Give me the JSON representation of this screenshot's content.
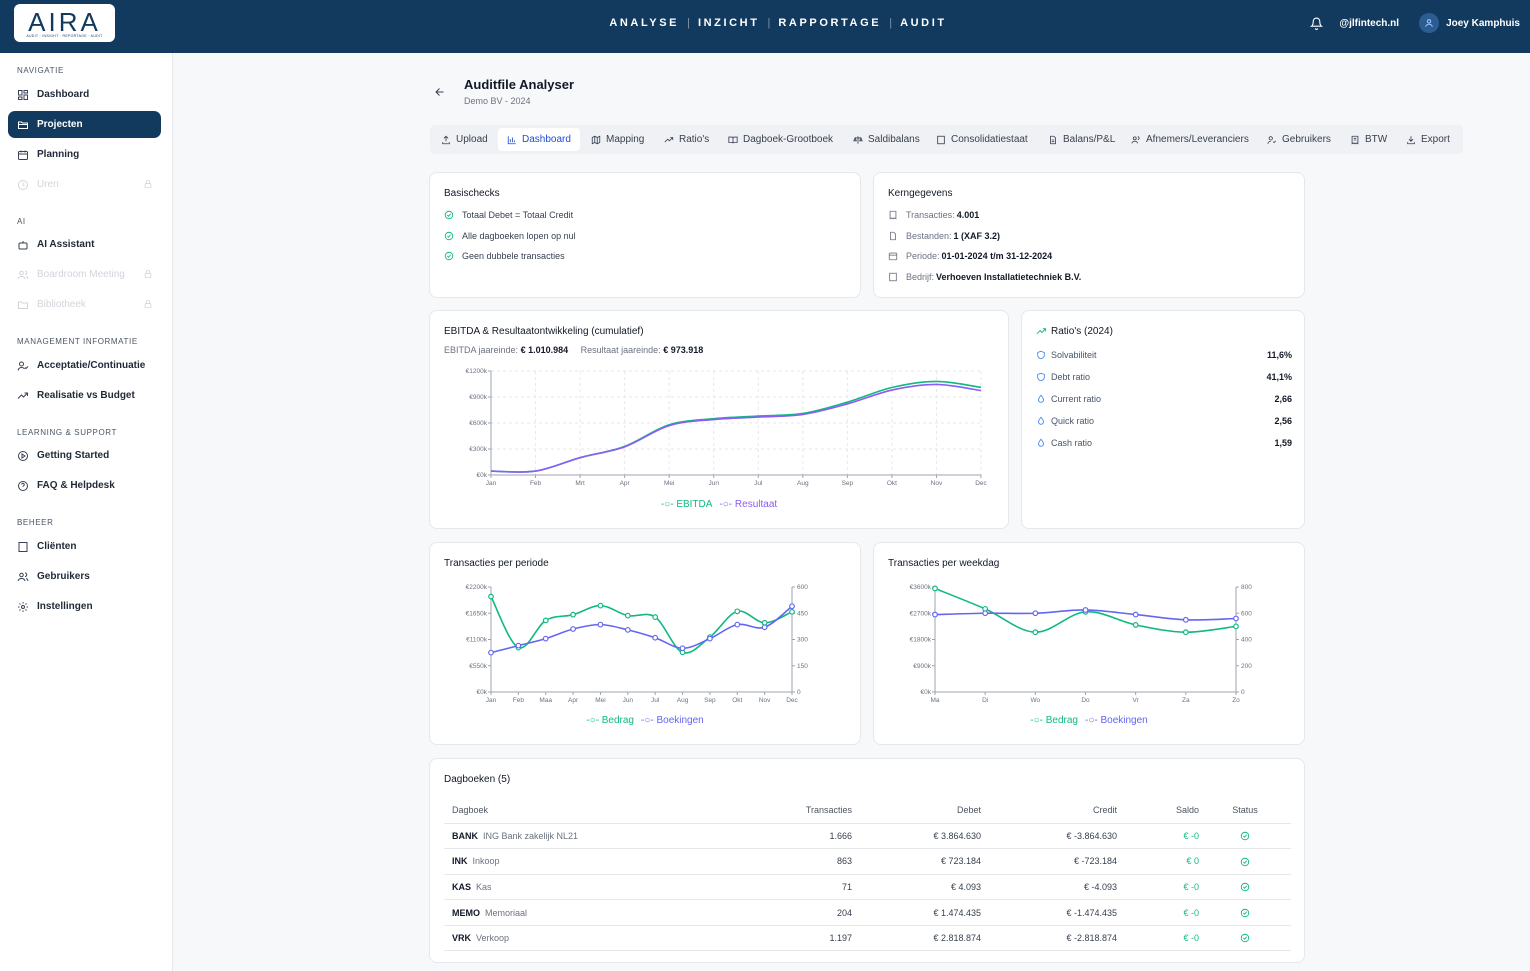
{
  "topbar": {
    "logo": "AIRA",
    "logo_tagline": "AUDIT · INSIGHT · REPORTAGE · AUDIT",
    "nav": [
      "ANALYSE",
      "INZICHT",
      "RAPPORTAGE",
      "AUDIT"
    ],
    "domain": "@jlfintech.nl",
    "user": "Joey Kamphuis"
  },
  "sidebar": {
    "navigatie_label": "NAVIGATIE",
    "ai_label": "AI",
    "mi_label": "MANAGEMENT INFORMATIE",
    "learning_label": "LEARNING & SUPPORT",
    "beheer_label": "BEHEER",
    "items": {
      "dashboard": "Dashboard",
      "projecten": "Projecten",
      "planning": "Planning",
      "uren": "Uren",
      "ai_assistant": "AI Assistant",
      "boardroom": "Boardroom Meeting",
      "bibliotheek": "Bibliotheek",
      "acceptatie": "Acceptatie/Continuatie",
      "realisatie": "Realisatie vs Budget",
      "getting_started": "Getting Started",
      "faq": "FAQ & Helpdesk",
      "clienten": "Cliënten",
      "gebruikers": "Gebruikers",
      "instellingen": "Instellingen"
    }
  },
  "page": {
    "title": "Auditfile Analyser",
    "subtitle": "Demo BV - 2024"
  },
  "tabs": [
    "Upload",
    "Dashboard",
    "Mapping",
    "Ratio's",
    "Dagboek-Grootboek",
    "Saldibalans",
    "Consolidatiestaat",
    "Balans/P&L",
    "Afnemers/Leveranciers",
    "Gebruikers",
    "BTW",
    "Export"
  ],
  "basischecks": {
    "title": "Basischecks",
    "items": [
      "Totaal Debet = Totaal Credit",
      "Alle dagboeken lopen op nul",
      "Geen dubbele transacties"
    ]
  },
  "kerngegevens": {
    "title": "Kerngegevens",
    "rows": [
      {
        "label": "Transacties:",
        "value": "4.001"
      },
      {
        "label": "Bestanden:",
        "value": "1 (XAF 3.2)"
      },
      {
        "label": "Periode:",
        "value": "01-01-2024 t/m 31-12-2024"
      },
      {
        "label": "Bedrijf:",
        "value": "Verhoeven Installatietechniek B.V."
      }
    ]
  },
  "ebitda": {
    "title": "EBITDA & Resultaatontwikkeling (cumulatief)",
    "ebitda_label": "EBITDA jaareinde:",
    "ebitda_value": "€ 1.010.984",
    "resultaat_label": "Resultaat jaareinde:",
    "resultaat_value": "€ 973.918"
  },
  "ratios": {
    "title": "Ratio's (2024)",
    "rows": [
      {
        "label": "Solvabiliteit",
        "value": "11,6%"
      },
      {
        "label": "Debt ratio",
        "value": "41,1%"
      },
      {
        "label": "Current ratio",
        "value": "2,66"
      },
      {
        "label": "Quick ratio",
        "value": "2,56"
      },
      {
        "label": "Cash ratio",
        "value": "1,59"
      }
    ]
  },
  "transacties_periode": {
    "title": "Transacties per periode"
  },
  "transacties_weekdag": {
    "title": "Transacties per weekdag"
  },
  "dagboeken": {
    "title": "Dagboeken (5)",
    "headers": [
      "Dagboek",
      "Transacties",
      "Debet",
      "Credit",
      "Saldo",
      "Status"
    ],
    "rows": [
      {
        "code": "BANK",
        "name": "ING Bank zakelijk NL21",
        "transacties": "1.666",
        "debet": "€ 3.864.630",
        "credit": "€ -3.864.630",
        "saldo": "€ -0"
      },
      {
        "code": "INK",
        "name": "Inkoop",
        "transacties": "863",
        "debet": "€ 723.184",
        "credit": "€ -723.184",
        "saldo": "€ 0"
      },
      {
        "code": "KAS",
        "name": "Kas",
        "transacties": "71",
        "debet": "€ 4.093",
        "credit": "€ -4.093",
        "saldo": "€ -0"
      },
      {
        "code": "MEMO",
        "name": "Memoriaal",
        "transacties": "204",
        "debet": "€ 1.474.435",
        "credit": "€ -1.474.435",
        "saldo": "€ -0"
      },
      {
        "code": "VRK",
        "name": "Verkoop",
        "transacties": "1.197",
        "debet": "€ 2.818.874",
        "credit": "€ -2.818.874",
        "saldo": "€ -0"
      }
    ]
  },
  "colors": {
    "navy": "#123a5f",
    "green": "#10b981",
    "purple": "#8b5cf6",
    "indigo": "#6366f1",
    "link_blue": "#1d4ed8"
  },
  "chart_data": [
    {
      "type": "line",
      "title": "EBITDA & Resultaatontwikkeling (cumulatief)",
      "categories": [
        "Jan",
        "Feb",
        "Mrt",
        "Apr",
        "Mei",
        "Jun",
        "Jul",
        "Aug",
        "Sep",
        "Okt",
        "Nov",
        "Dec"
      ],
      "y_ticks": [
        "€0k",
        "€300k",
        "€600k",
        "€900k",
        "€1200k"
      ],
      "ylim": [
        0,
        1200000
      ],
      "grid": true,
      "legend": "bottom",
      "series": [
        {
          "name": "EBITDA",
          "color": "#10b981",
          "values": [
            45000,
            45000,
            200000,
            330000,
            580000,
            650000,
            680000,
            710000,
            840000,
            1010000,
            1080000,
            1011000
          ]
        },
        {
          "name": "Resultaat",
          "color": "#8b5cf6",
          "values": [
            45000,
            45000,
            200000,
            325000,
            570000,
            640000,
            668000,
            698000,
            820000,
            980000,
            1045000,
            974000
          ]
        }
      ]
    },
    {
      "type": "line",
      "title": "Transacties per periode",
      "categories": [
        "Jan",
        "Feb",
        "Maa",
        "Apr",
        "Mei",
        "Jun",
        "Jul",
        "Aug",
        "Sep",
        "Okt",
        "Nov",
        "Dec"
      ],
      "y_ticks": [
        "€0k",
        "€550k",
        "€1100k",
        "€1650k",
        "€2200k"
      ],
      "ylim": [
        0,
        2200000
      ],
      "y2_ticks": [
        "0",
        "150",
        "300",
        "450",
        "600"
      ],
      "y2lim": [
        0,
        600
      ],
      "grid": false,
      "legend": "bottom",
      "series": [
        {
          "name": "Bedrag",
          "color": "#10b981",
          "axis": "left",
          "values": [
            2000000,
            930000,
            1500000,
            1620000,
            1810000,
            1600000,
            1570000,
            830000,
            1150000,
            1690000,
            1450000,
            1680000
          ]
        },
        {
          "name": "Boekingen",
          "color": "#6366f1",
          "axis": "right",
          "values": [
            225,
            265,
            305,
            360,
            385,
            355,
            310,
            250,
            305,
            385,
            370,
            490
          ]
        }
      ]
    },
    {
      "type": "line",
      "title": "Transacties per weekdag",
      "categories": [
        "Ma",
        "Di",
        "Wo",
        "Do",
        "Vr",
        "Za",
        "Zo"
      ],
      "y_ticks": [
        "€0k",
        "€900k",
        "€1800k",
        "€2700k",
        "€3600k"
      ],
      "ylim": [
        0,
        3600000
      ],
      "y2_ticks": [
        "0",
        "200",
        "400",
        "600",
        "800"
      ],
      "y2lim": [
        0,
        800
      ],
      "grid": false,
      "legend": "bottom",
      "series": [
        {
          "name": "Bedrag",
          "color": "#10b981",
          "axis": "left",
          "values": [
            3550000,
            2850000,
            2050000,
            2750000,
            2300000,
            2050000,
            2250000
          ]
        },
        {
          "name": "Boekingen",
          "color": "#6366f1",
          "axis": "right",
          "values": [
            590,
            600,
            600,
            625,
            590,
            550,
            560
          ]
        }
      ]
    }
  ]
}
